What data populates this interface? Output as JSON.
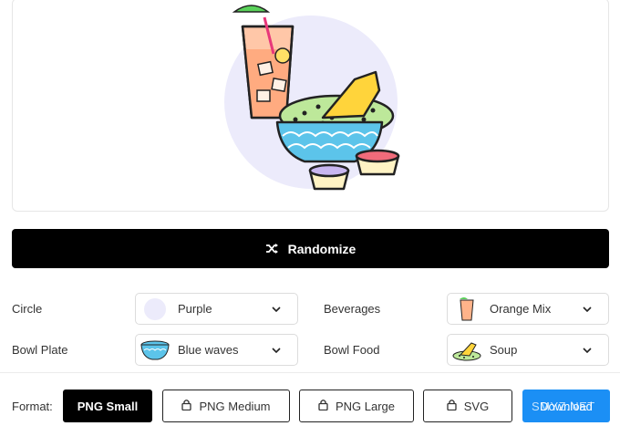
{
  "actions": {
    "randomize_label": "Randomize"
  },
  "options": [
    {
      "label": "Circle",
      "value": "Purple",
      "thumb": "circle-swatch"
    },
    {
      "label": "Beverages",
      "value": "Orange Mix",
      "thumb": "orange-mix-drink"
    },
    {
      "label": "Bowl Plate",
      "value": "Blue waves",
      "thumb": "blue-bowl"
    },
    {
      "label": "Bowl Food",
      "value": "Soup",
      "thumb": "soup-food"
    }
  ],
  "format": {
    "label": "Format:",
    "buttons": [
      {
        "label": "PNG Small",
        "active": true,
        "locked": false
      },
      {
        "label": "PNG Medium",
        "active": false,
        "locked": true
      },
      {
        "label": "PNG Large",
        "active": false,
        "locked": true
      },
      {
        "label": "SVG",
        "active": false,
        "locked": true
      }
    ],
    "download_label": "Download"
  },
  "watermark": "SMYZ.NET",
  "colors": {
    "accent": "#1b8ff5",
    "circle": "#ecebfb",
    "primary": "#000000"
  }
}
